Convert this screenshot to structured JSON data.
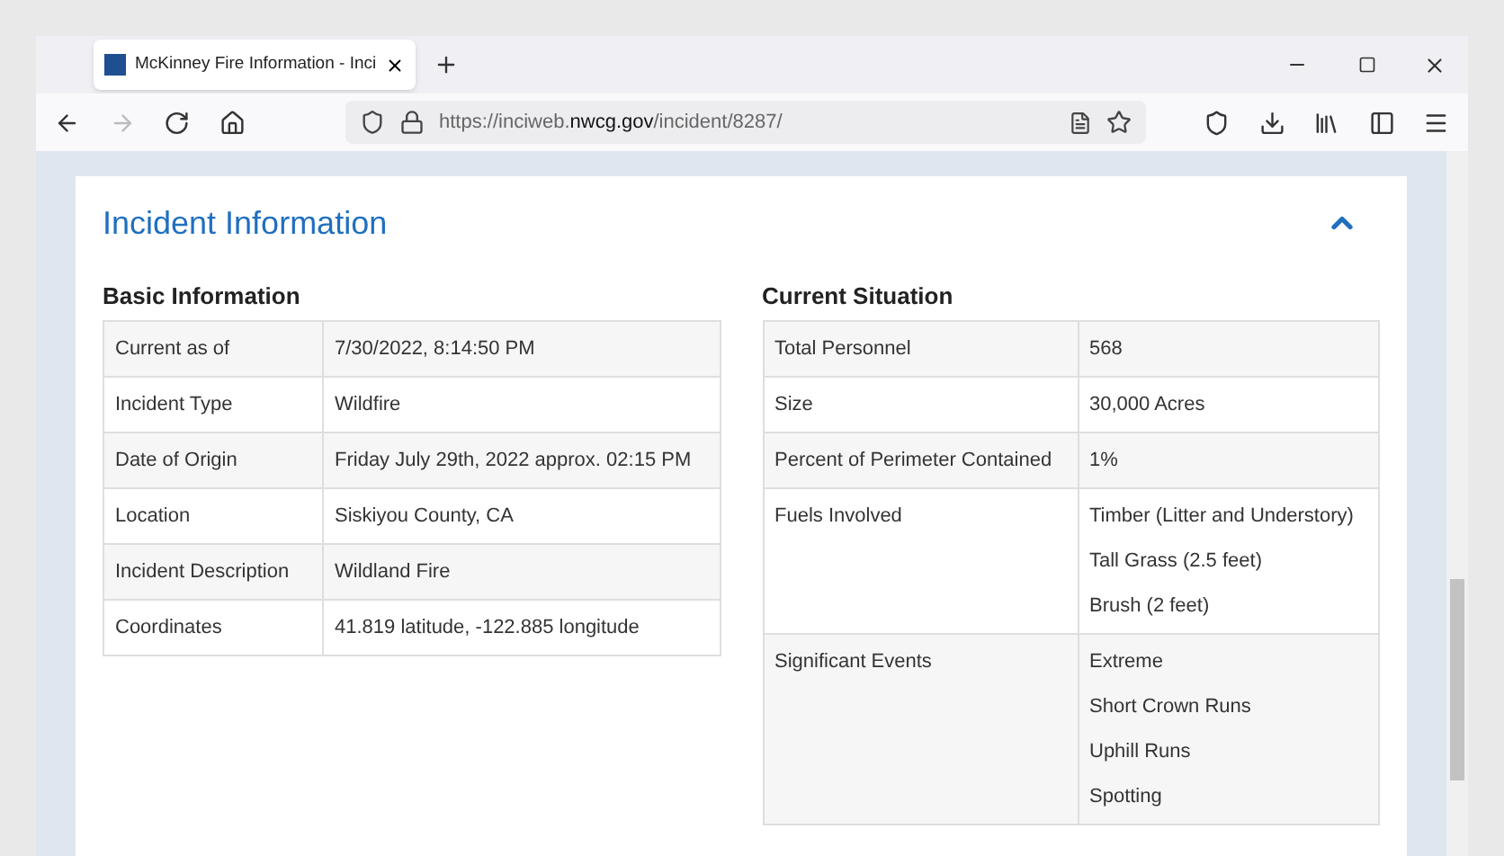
{
  "tab": {
    "title": "McKinney Fire Information - Inci",
    "selected": true
  },
  "address_bar": {
    "url_prefix": "https://inciweb.",
    "url_domain": "nwcg.gov",
    "url_path": "/incident/8287/"
  },
  "section": {
    "title": "Incident Information",
    "expanded": true
  },
  "basic_information": {
    "heading": "Basic Information",
    "rows": [
      {
        "label": "Current as of",
        "values": [
          "7/30/2022, 8:14:50 PM"
        ]
      },
      {
        "label": "Incident Type",
        "values": [
          "Wildfire"
        ]
      },
      {
        "label": "Date of Origin",
        "values": [
          "Friday July 29th, 2022 approx. 02:15 PM"
        ]
      },
      {
        "label": "Location",
        "values": [
          "Siskiyou County, CA"
        ]
      },
      {
        "label": "Incident Description",
        "values": [
          "Wildland Fire"
        ]
      },
      {
        "label": "Coordinates",
        "values": [
          "41.819 latitude, -122.885 longitude"
        ]
      }
    ]
  },
  "current_situation": {
    "heading": "Current Situation",
    "rows": [
      {
        "label": "Total Personnel",
        "values": [
          "568"
        ]
      },
      {
        "label": "Size",
        "values": [
          "30,000 Acres"
        ]
      },
      {
        "label": "Percent of Perimeter Contained",
        "values": [
          "1%"
        ]
      },
      {
        "label": "Fuels Involved",
        "values": [
          "Timber (Litter and Understory)",
          "Tall Grass (2.5 feet)",
          "Brush (2 feet)"
        ]
      },
      {
        "label": "Significant Events",
        "values": [
          "Extreme",
          "Short Crown Runs",
          "Uphill Runs",
          "Spotting"
        ]
      }
    ]
  }
}
